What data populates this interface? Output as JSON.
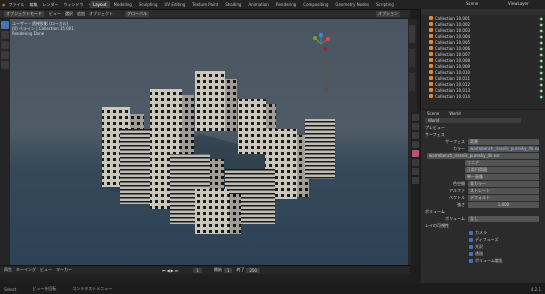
{
  "menu": [
    "ファイル",
    "編集",
    "レンダー",
    "ウィンドウ",
    "ヘルプ"
  ],
  "workspaces": [
    "Layout",
    "Modeling",
    "Sculpting",
    "UV Editing",
    "Texture Paint",
    "Shading",
    "Animation",
    "Rendering",
    "Compositing",
    "Geometry Nodes",
    "Scripting"
  ],
  "scene_name": "Scene",
  "view_layer": "ViewLayer",
  "viewport": {
    "mode": "オブジェクトモード",
    "header_items": [
      "ビュー",
      "選択",
      "追加",
      "オブジェクト"
    ],
    "orientation": "グローバル",
    "info_line1": "ユーザー・透視投影 (ローカル)",
    "info_line2": "(0) ペライン | Collection 15.001",
    "info_line3": "Rendering Done",
    "options": "オプション",
    "snap": "スナップ",
    "select_box": "Drag",
    "shading": "Shading",
    "overlay": "Main Displacement"
  },
  "outliner": {
    "items": [
      "Collection 10.001",
      "Collection 10.002",
      "Collection 10.003",
      "Collection 10.004",
      "Collection 10.005",
      "Collection 10.006",
      "Collection 10.007",
      "Collection 10.008",
      "Collection 10.009",
      "Collection 10.010",
      "Collection 10.011",
      "Collection 10.012",
      "Collection 10.013",
      "Collection 10.014"
    ]
  },
  "properties": {
    "breadcrumb": "Scene",
    "world": "World",
    "section_preview": "プレビュー",
    "section_surface": "サーフェス",
    "surface_label": "サーフェス",
    "surface_value": "背景",
    "color_label": "カラー",
    "color_value": "warmbench_riesnik_puresky_4k.exr",
    "image_name": "warmbench_riesnik_puresky_4k.exr",
    "linear": "リニア",
    "projection": "正距円筒図",
    "single_image": "単一画像",
    "colorspace_label": "色空間",
    "colorspace_value": "非カラー",
    "alpha_label": "アルファ",
    "alpha_value": "ストレート",
    "vector_label": "ベクトル",
    "vector_value": "デフォルト",
    "strength_label": "強さ",
    "strength_value": "1.000",
    "section_volume": "ボリューム",
    "volume_label": "ボリューム",
    "volume_value": "なし",
    "section_ray": "レイの可視性",
    "ray_items": [
      "カメラ",
      "ディフューズ",
      "光沢",
      "透過",
      "ボリューム散乱"
    ]
  },
  "timeline": {
    "playback": "再生",
    "keying": "キーイング",
    "view": "ビュー",
    "marker": "マーカー",
    "frame": "1",
    "start_label": "開始",
    "start": "1",
    "end_label": "終了",
    "end": "250"
  },
  "status": {
    "left": "Select",
    "mid": "ビューを回転",
    "right": "コンテキストメニュー",
    "version": "4.2.1"
  }
}
